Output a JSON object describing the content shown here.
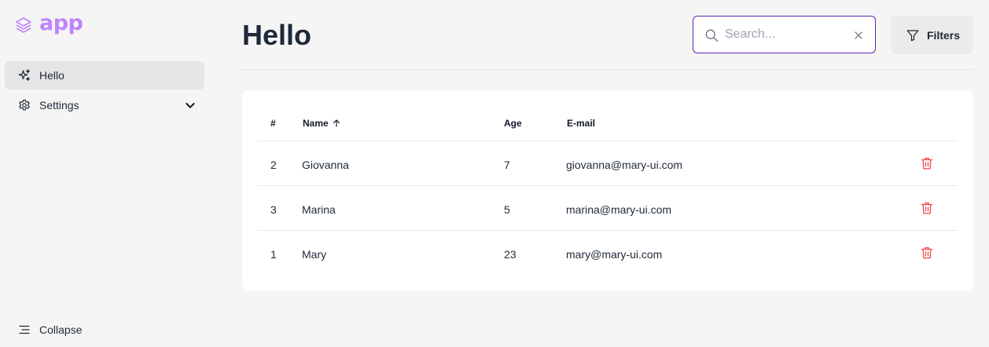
{
  "brand": {
    "name": "app"
  },
  "sidebar": {
    "items": [
      {
        "label": "Hello",
        "icon": "sparkles-icon",
        "active": true
      },
      {
        "label": "Settings",
        "icon": "gear-icon",
        "expandable": true
      }
    ],
    "collapse_label": "Collapse"
  },
  "header": {
    "title": "Hello",
    "search": {
      "placeholder": "Search...",
      "value": ""
    },
    "filters_label": "Filters"
  },
  "table": {
    "columns": [
      "#",
      "Name",
      "Age",
      "E-mail"
    ],
    "sort": {
      "column": "Name",
      "direction": "asc"
    },
    "rows": [
      {
        "id": "2",
        "name": "Giovanna",
        "age": "7",
        "email": "giovanna@mary-ui.com"
      },
      {
        "id": "3",
        "name": "Marina",
        "age": "5",
        "email": "marina@mary-ui.com"
      },
      {
        "id": "1",
        "name": "Mary",
        "age": "23",
        "email": "mary@mary-ui.com"
      }
    ]
  },
  "colors": {
    "accent": "#5b21b6",
    "brand_gradient": [
      "#a855f7",
      "#f9a8d4"
    ],
    "danger": "#ef4444",
    "background": "#f5f5f5"
  }
}
